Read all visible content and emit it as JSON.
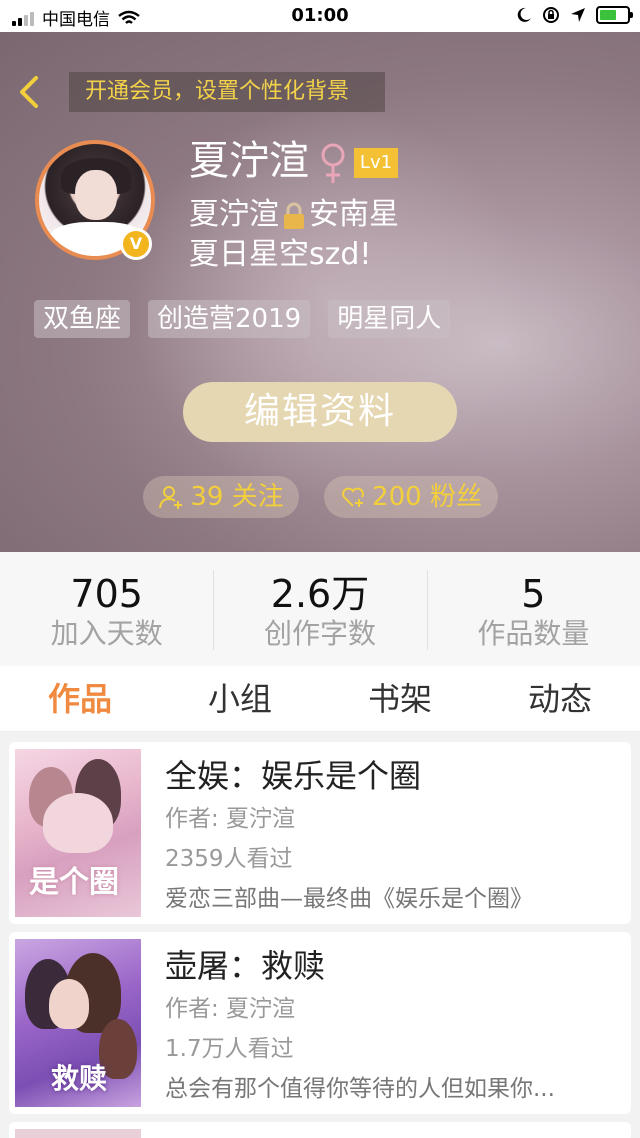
{
  "status_bar": {
    "carrier": "中国电信",
    "time": "01:00"
  },
  "header": {
    "vip_banner": "开通会员，设置个性化背景"
  },
  "profile": {
    "name": "夏泞渲",
    "gender_symbol": "♀",
    "level": "Lv1",
    "verified_mark": "V",
    "bio_part1": "夏泞渲",
    "bio_part2": "安南星",
    "bio_line2": "夏日星空szd!",
    "tags": [
      "双鱼座",
      "创造营2019",
      "明星同人"
    ],
    "edit_button": "编辑资料",
    "following": "39 关注",
    "followers": "200 粉丝"
  },
  "stats": [
    {
      "value": "705",
      "label": "加入天数"
    },
    {
      "value": "2.6万",
      "label": "创作字数"
    },
    {
      "value": "5",
      "label": "作品数量"
    }
  ],
  "tabs": [
    "作品",
    "小组",
    "书架",
    "动态"
  ],
  "active_tab": "作品",
  "books": [
    {
      "title": "全娱：娱乐是个圈",
      "author": "作者: 夏泞渲",
      "views": "2359人看过",
      "description": "爱恋三部曲—最终曲《娱乐是个圈》",
      "cover_text": "是个圈"
    },
    {
      "title": "壶屠：救赎",
      "author": "作者: 夏泞渲",
      "views": "1.7万人看过",
      "description": "总会有那个值得你等待的人但如果你...",
      "cover_text": "救赎"
    }
  ],
  "colors": {
    "accent_orange": "#f08a40",
    "gold": "#f3cf3b",
    "avatar_border": "#e98c52"
  }
}
